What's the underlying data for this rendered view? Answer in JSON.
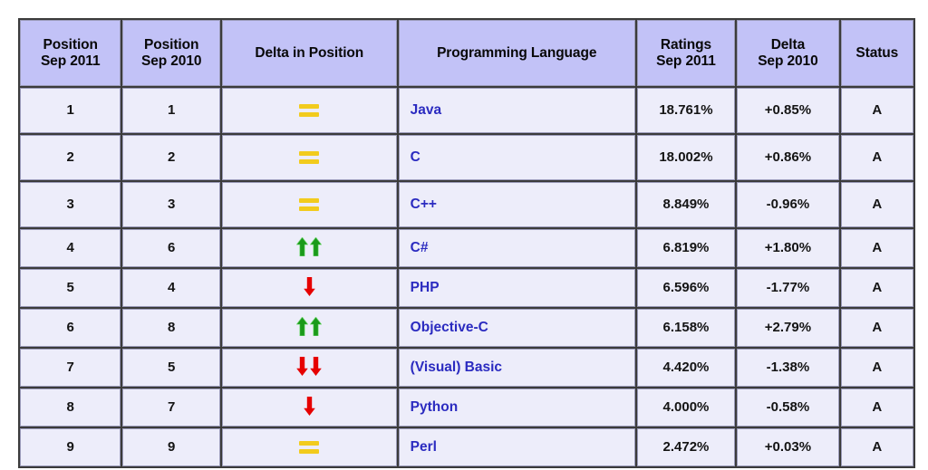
{
  "table": {
    "columns": [
      {
        "key": "position_new",
        "line1": "Position",
        "line2": "Sep 2011"
      },
      {
        "key": "position_old",
        "line1": "Position",
        "line2": "Sep 2010"
      },
      {
        "key": "delta_position",
        "line1": "Delta in Position",
        "line2": ""
      },
      {
        "key": "language",
        "line1": "Programming Language",
        "line2": ""
      },
      {
        "key": "ratings",
        "line1": "Ratings",
        "line2": "Sep 2011"
      },
      {
        "key": "delta_pct",
        "line1": "Delta",
        "line2": "Sep 2010"
      },
      {
        "key": "status",
        "line1": "Status",
        "line2": ""
      }
    ],
    "colors": {
      "header_background": "#c2c2f7",
      "cell_background": "#ededfa",
      "grid": "#3b3b3b",
      "language_text": "#2b2bc0",
      "up_arrow": "#1a9a1a",
      "down_arrow": "#e60000",
      "equal_bars": "#f2cb1d"
    },
    "rows": [
      {
        "position_new": "1",
        "position_old": "1",
        "delta_icon": "equal-icon",
        "delta_count": 2,
        "language": "Java",
        "ratings": "18.761%",
        "delta_pct": "+0.85%",
        "status": "A"
      },
      {
        "position_new": "2",
        "position_old": "2",
        "delta_icon": "equal-icon",
        "delta_count": 2,
        "language": "C",
        "ratings": "18.002%",
        "delta_pct": "+0.86%",
        "status": "A"
      },
      {
        "position_new": "3",
        "position_old": "3",
        "delta_icon": "equal-icon",
        "delta_count": 2,
        "language": "C++",
        "ratings": "8.849%",
        "delta_pct": "-0.96%",
        "status": "A"
      },
      {
        "position_new": "4",
        "position_old": "6",
        "delta_icon": "arrow-up-icon",
        "delta_count": 2,
        "language": "C#",
        "ratings": "6.819%",
        "delta_pct": "+1.80%",
        "status": "A"
      },
      {
        "position_new": "5",
        "position_old": "4",
        "delta_icon": "arrow-down-icon",
        "delta_count": 1,
        "language": "PHP",
        "ratings": "6.596%",
        "delta_pct": "-1.77%",
        "status": "A"
      },
      {
        "position_new": "6",
        "position_old": "8",
        "delta_icon": "arrow-up-icon",
        "delta_count": 2,
        "language": "Objective-C",
        "ratings": "6.158%",
        "delta_pct": "+2.79%",
        "status": "A"
      },
      {
        "position_new": "7",
        "position_old": "5",
        "delta_icon": "arrow-down-icon",
        "delta_count": 2,
        "language": "(Visual) Basic",
        "ratings": "4.420%",
        "delta_pct": "-1.38%",
        "status": "A"
      },
      {
        "position_new": "8",
        "position_old": "7",
        "delta_icon": "arrow-down-icon",
        "delta_count": 1,
        "language": "Python",
        "ratings": "4.000%",
        "delta_pct": "-0.58%",
        "status": "A"
      },
      {
        "position_new": "9",
        "position_old": "9",
        "delta_icon": "equal-icon",
        "delta_count": 2,
        "language": "Perl",
        "ratings": "2.472%",
        "delta_pct": "+0.03%",
        "status": "A"
      }
    ]
  }
}
